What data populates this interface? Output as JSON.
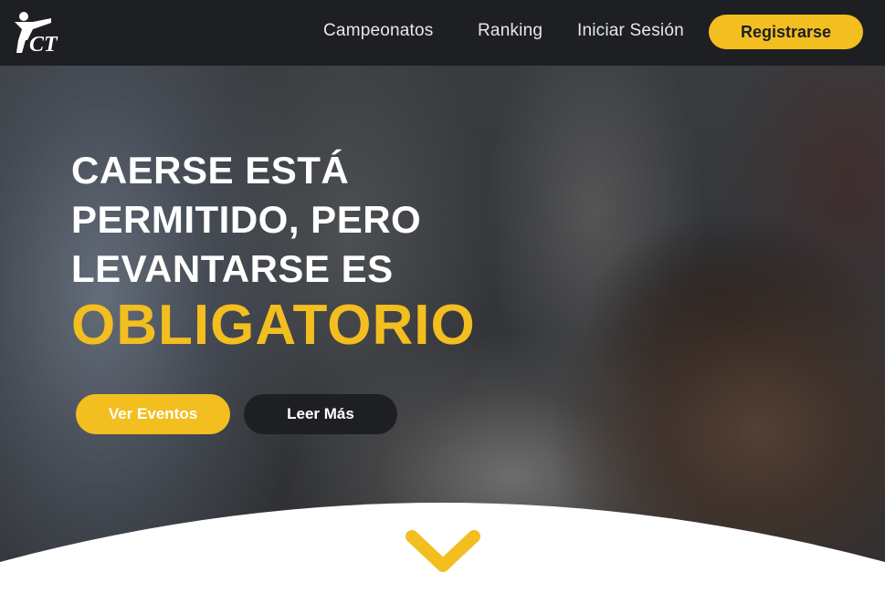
{
  "navbar": {
    "logo_text": "CT",
    "links": [
      "Campeonatos",
      "Ranking",
      "Iniciar Sesión"
    ],
    "register_label": "Registrarse"
  },
  "hero": {
    "title_lines": [
      "CAERSE ESTÁ",
      "PERMITIDO, PERO",
      "LEVANTARSE ES"
    ],
    "title_accent": "OBLIGATORIO",
    "primary_button": "Ver Eventos",
    "secondary_button": "Leer Más"
  },
  "icons": {
    "scroll": "chevron-down-icon",
    "logo": "karate-kick-logo"
  },
  "colors": {
    "navbar_bg": "#1d1f23",
    "accent": "#f3be1f",
    "dark_button": "#1d1f23",
    "text_light": "#ffffff"
  }
}
